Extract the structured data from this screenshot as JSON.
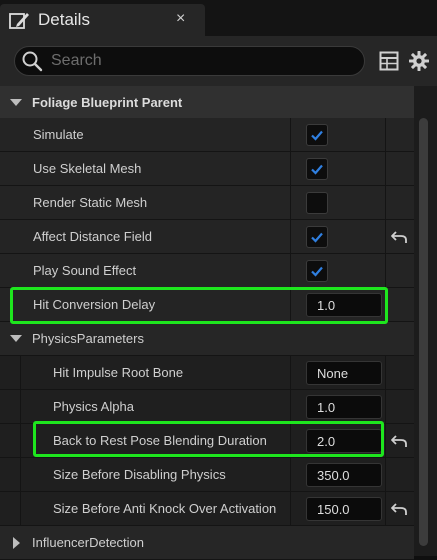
{
  "tab": {
    "title": "Details",
    "close": "×"
  },
  "search": {
    "placeholder": "Search",
    "value": ""
  },
  "sections": {
    "foliage": "Foliage Blueprint Parent",
    "physics": "PhysicsParameters",
    "influencer": "InfluencerDetection"
  },
  "properties": {
    "simulate": {
      "label": "Simulate",
      "checked": true
    },
    "use_skeletal_mesh": {
      "label": "Use Skeletal Mesh",
      "checked": true
    },
    "render_static_mesh": {
      "label": "Render Static Mesh",
      "checked": false
    },
    "affect_distance_field": {
      "label": "Affect Distance Field",
      "checked": true
    },
    "play_sound_effect": {
      "label": "Play Sound Effect",
      "checked": true
    },
    "hit_conversion_delay": {
      "label": "Hit Conversion Delay",
      "value": "1.0"
    },
    "hit_impulse_root_bone": {
      "label": "Hit Impulse Root Bone",
      "value": "None"
    },
    "physics_alpha": {
      "label": "Physics Alpha",
      "value": "1.0"
    },
    "back_to_rest": {
      "label": "Back to Rest Pose Blending Duration",
      "value": "2.0"
    },
    "size_before_disabling": {
      "label": "Size Before Disabling Physics",
      "value": "350.0"
    },
    "size_before_anti_knock": {
      "label": "Size Before Anti Knock Over Activation",
      "value": "150.0"
    }
  },
  "colors": {
    "checkbox_check": "#2f7fe0",
    "highlight": "#1ee61e"
  }
}
